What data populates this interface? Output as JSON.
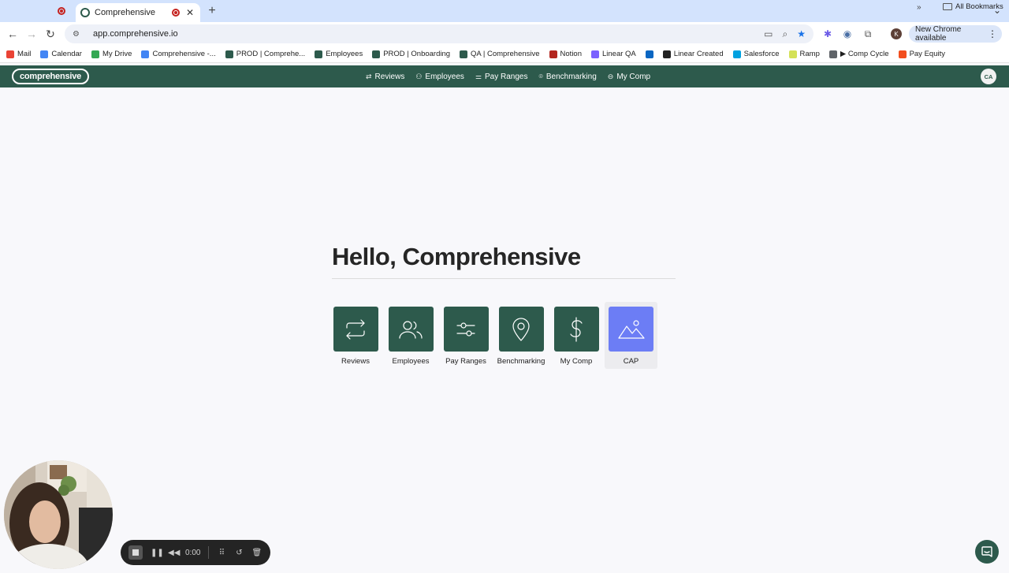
{
  "browser": {
    "active_tab_title": "Comprehensive",
    "url": "app.comprehensive.io",
    "new_chrome_label": "New Chrome available",
    "profile_initial": "K",
    "bookmarks": [
      {
        "label": "Mail",
        "color": "#ea4335"
      },
      {
        "label": "Calendar",
        "color": "#4285f4"
      },
      {
        "label": "My Drive",
        "color": "#34a853"
      },
      {
        "label": "Comprehensive -...",
        "color": "#4285f4"
      },
      {
        "label": "PROD | Comprehe...",
        "color": "#2d5a4c"
      },
      {
        "label": "Employees",
        "color": "#2d5a4c"
      },
      {
        "label": "PROD | Onboarding",
        "color": "#2d5a4c"
      },
      {
        "label": "QA | Comprehensive",
        "color": "#2d5a4c"
      },
      {
        "label": "Notion",
        "color": "#b3261e"
      },
      {
        "label": "Linear QA",
        "color": "#7b61ff"
      },
      {
        "label": "",
        "color": "#0a66c2"
      },
      {
        "label": "Linear Created",
        "color": "#222222"
      },
      {
        "label": "Salesforce",
        "color": "#00a1e0"
      },
      {
        "label": "Ramp",
        "color": "#d4e157"
      },
      {
        "label": "▶ Comp Cycle",
        "color": "#5f6368"
      },
      {
        "label": "Pay Equity",
        "color": "#f24e1e"
      }
    ],
    "all_bookmarks_label": "All Bookmarks"
  },
  "app": {
    "logo_text": "comprehensive",
    "nav": [
      {
        "label": "Reviews",
        "icon": "⇄"
      },
      {
        "label": "Employees",
        "icon": "⚇"
      },
      {
        "label": "Pay Ranges",
        "icon": "⚌"
      },
      {
        "label": "Benchmarking",
        "icon": "⌾"
      },
      {
        "label": "My Comp",
        "icon": "⊖"
      }
    ],
    "avatar_initials": "CA"
  },
  "main": {
    "greeting": "Hello, Comprehensive",
    "tiles": [
      {
        "label": "Reviews",
        "icon": "reviews-icon"
      },
      {
        "label": "Employees",
        "icon": "employees-icon"
      },
      {
        "label": "Pay Ranges",
        "icon": "sliders-icon"
      },
      {
        "label": "Benchmarking",
        "icon": "map-pin-icon"
      },
      {
        "label": "My Comp",
        "icon": "dollar-icon"
      },
      {
        "label": "CAP",
        "icon": "mountain-image-icon"
      }
    ]
  },
  "recorder": {
    "timer": "0:00"
  },
  "colors": {
    "brand": "#2d5a4c",
    "cap_accent": "#6c7df5"
  }
}
